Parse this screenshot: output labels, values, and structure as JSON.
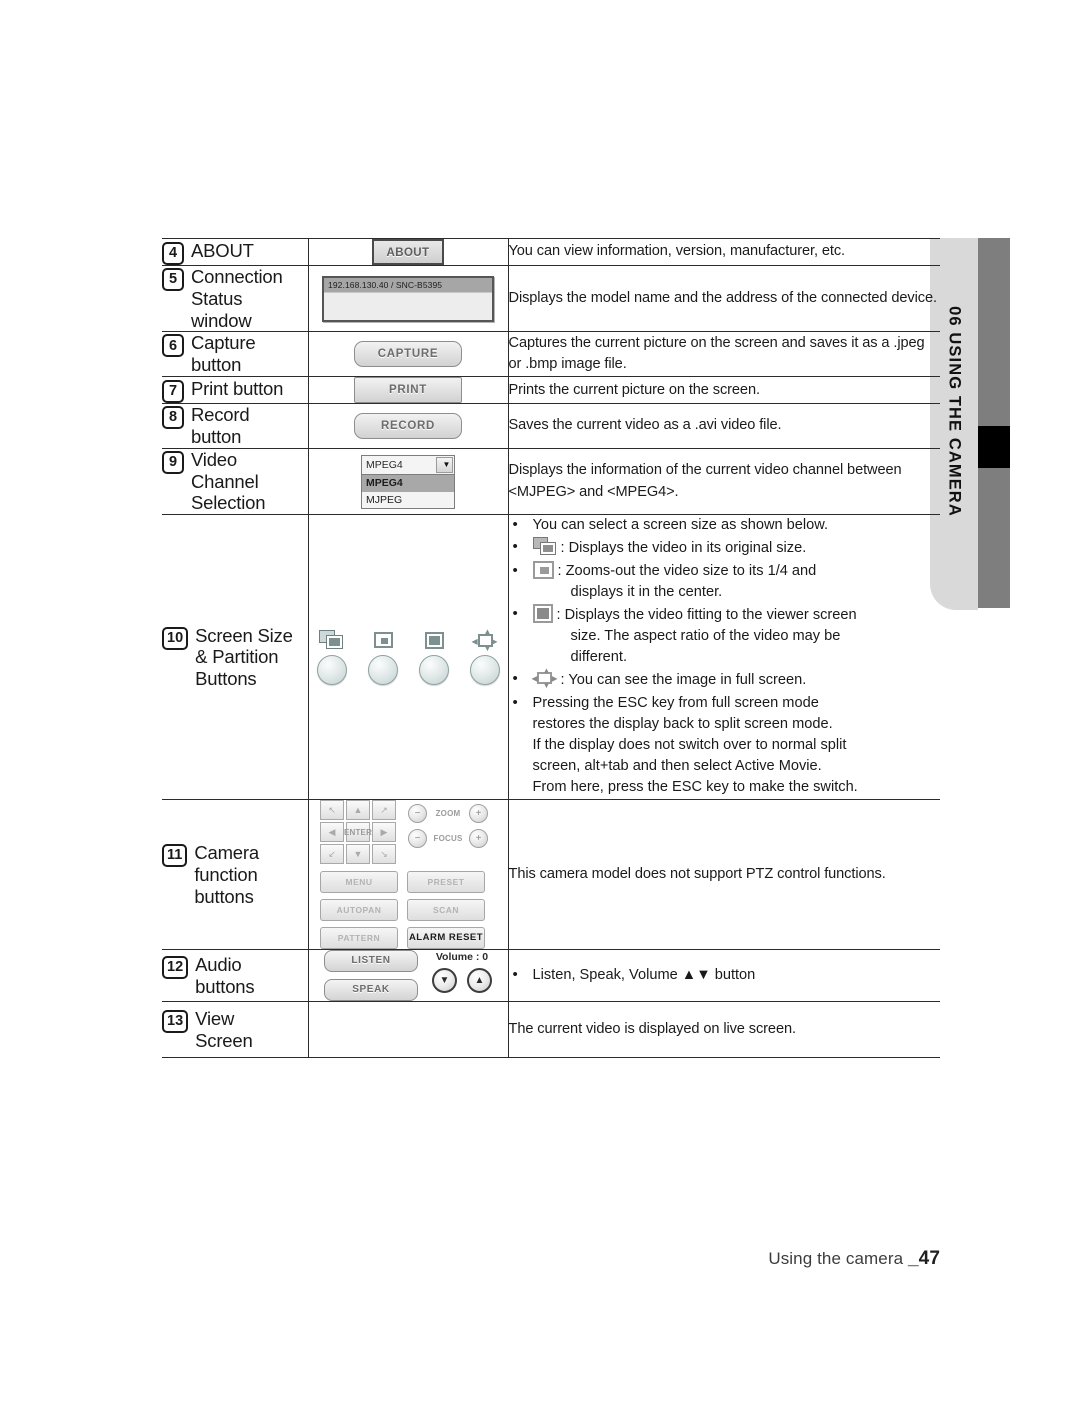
{
  "sidebar": {
    "label": "06  USING THE CAMERA"
  },
  "footer": {
    "text": "Using the camera ",
    "page": "_47"
  },
  "table": {
    "rows": [
      {
        "num": "4",
        "label": "ABOUT",
        "widget": "about-button",
        "widget_text": "ABOUT",
        "desc": "You can view information, version, manufacturer, etc."
      },
      {
        "num": "5",
        "label": "Connection Status window",
        "widget": "status-window",
        "widget_text": "192.168.130.40 / SNC-B5395",
        "desc": "Displays the model name and the address of the connected device."
      },
      {
        "num": "6",
        "label": "Capture button",
        "widget": "capture-button",
        "widget_text": "CAPTURE",
        "desc": "Captures the current picture on the screen and saves it as a .jpeg or .bmp image file."
      },
      {
        "num": "7",
        "label": "Print button",
        "widget": "print-button",
        "widget_text": "PRINT",
        "desc": "Prints the current picture on the screen."
      },
      {
        "num": "8",
        "label": "Record button",
        "widget": "record-button",
        "widget_text": "RECORD",
        "desc": "Saves the current video as a .avi video file."
      },
      {
        "num": "9",
        "label": "Video Channel Selection",
        "widget": "video-channel-combo",
        "widget_text": "MPEG4",
        "desc": "Displays the information of the current video channel between <MJPEG> and <MPEG4>."
      },
      {
        "num": "10",
        "label": "Screen Size & Partition Buttons",
        "widget": "screen-size-buttons",
        "desc": "bullets"
      },
      {
        "num": "11",
        "label": "Camera function buttons",
        "widget": "ptz-panel",
        "desc": "This camera model does not support PTZ control functions."
      },
      {
        "num": "12",
        "label": "Audio buttons",
        "widget": "audio-panel",
        "desc": "Listen, Speak, Volume ▲▼ button"
      },
      {
        "num": "13",
        "label": "View Screen",
        "widget": "none",
        "desc": "The current video is displayed on live screen."
      }
    ]
  },
  "combo": {
    "selected": "MPEG4",
    "options": [
      "MPEG4",
      "MJPEG"
    ],
    "arrow": "▼"
  },
  "screen_size_bullets": {
    "intro": "You can select a screen size as shown below.",
    "original": ": Displays the video in its original size.",
    "quarter": ": Zooms-out the video size to its 1/4 and",
    "quarter_cont": "displays it in the center.",
    "fit": ": Displays the video fitting to the viewer screen",
    "fit_cont1": "size. The aspect ratio of the video may be",
    "fit_cont2": "different.",
    "full": ": You can see the image in full screen.",
    "esc1": "Pressing the ESC key from full screen mode",
    "esc2": "restores the display back to split screen mode.",
    "esc3": "If the display does not switch over to normal split",
    "esc4": "screen, alt+tab and then select Active Movie.",
    "esc5": "From here, press the ESC key to make the switch."
  },
  "ptz": {
    "dpad": {
      "up_left": "↖",
      "up": "▲",
      "up_right": "↗",
      "left": "◀",
      "enter": "ENTER",
      "right": "▶",
      "down_left": "↙",
      "down": "▼",
      "down_right": "↘"
    },
    "zoom_label": "ZOOM",
    "focus_label": "FOCUS",
    "minus": "−",
    "plus": "+",
    "buttons": [
      "MENU",
      "PRESET",
      "AUTOPAN",
      "SCAN",
      "PATTERN",
      "ALARM RESET"
    ]
  },
  "audio": {
    "listen": "LISTEN",
    "speak": "SPEAK",
    "volume_label": "Volume : 0",
    "down": "▼",
    "up": "▲"
  },
  "colors": {
    "rule": "#2b2b2b",
    "tab_light": "#d9d9d9",
    "tab_dark": "#7e7e7e",
    "tab_black": "#000000"
  }
}
